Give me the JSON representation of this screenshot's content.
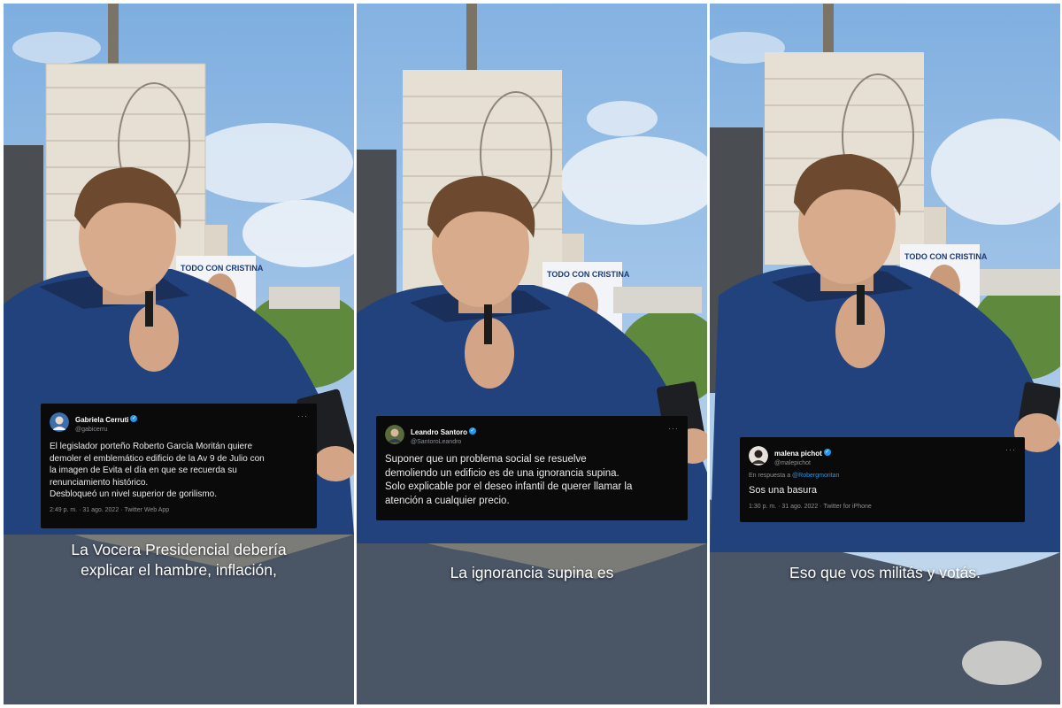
{
  "panels": [
    {
      "tweet": {
        "name": "Gabriela Cerruti",
        "handle": "@gabicerru",
        "text_lines": [
          "El legislador porteño Roberto García Moritán quiere",
          "demoler el emblemático edificio de la Av 9 de Julio con",
          "la imagen de Evita el día en que se recuerda su",
          "renunciamiento histórico.",
          "Desbloqueó un nivel superior de gorilismo."
        ],
        "meta": "2:49 p. m. · 31 ago. 2022 · Twitter Web App"
      },
      "caption_lines": [
        "La Vocera Presidencial debería",
        "explicar el hambre, inflación,"
      ]
    },
    {
      "tweet": {
        "name": "Leandro Santoro",
        "handle": "@SantoroLeandro",
        "text_lines": [
          "Suponer que un problema social se resuelve",
          "demoliendo un edificio es de una ignorancia supina.",
          "Solo explicable por el deseo infantil de querer llamar la",
          "atención a cualquier precio."
        ]
      },
      "caption_lines": [
        "La ignorancia supina es"
      ]
    },
    {
      "tweet": {
        "name": "malena pichot",
        "handle": "@malepichot",
        "reply_prefix": "En respuesta a",
        "reply_to": "@Robergmoritan",
        "text_lines": [
          "Sos una basura"
        ],
        "meta": "1:30 p. m. · 31 ago. 2022 · Twitter for iPhone"
      },
      "caption_lines": [
        "Eso que vos militás y votás."
      ]
    }
  ],
  "banner_text": "TODO CON CRISTINA",
  "icons": {
    "verified": "verified-badge-icon",
    "more": "more-dots-icon"
  },
  "colors": {
    "sky": "#a9c6e6",
    "building": "#e8e3d9",
    "jacket": "#1f3e78",
    "tweet_bg": "#0a0a0a",
    "verified": "#1d9bf0"
  }
}
